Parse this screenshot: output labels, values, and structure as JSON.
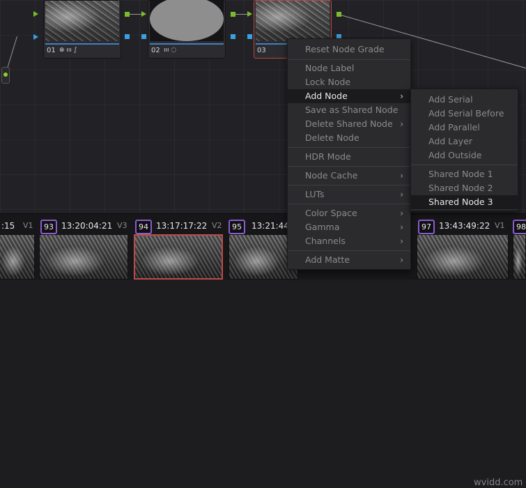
{
  "nodes": [
    {
      "id": "node-01",
      "label": "01",
      "icons": "⊗ ııı ∫"
    },
    {
      "id": "node-02",
      "label": "02",
      "icons": "ııı ◌"
    },
    {
      "id": "node-03",
      "label": "03",
      "icons": ""
    }
  ],
  "context_menu": {
    "items": [
      {
        "label": "Reset Node Grade"
      },
      {
        "label": "Node Label"
      },
      {
        "label": "Lock Node"
      },
      {
        "label": "Add Node",
        "submenu": true
      },
      {
        "label": "Save as Shared Node"
      },
      {
        "label": "Delete Shared Node",
        "submenu": true
      },
      {
        "label": "Delete Node"
      },
      {
        "label": "HDR Mode"
      },
      {
        "label": "Node Cache",
        "submenu": true
      },
      {
        "label": "LUTs",
        "submenu": true
      },
      {
        "label": "Color Space",
        "submenu": true
      },
      {
        "label": "Gamma",
        "submenu": true
      },
      {
        "label": "Channels",
        "submenu": true
      },
      {
        "label": "Add Matte",
        "submenu": true
      }
    ],
    "active_item": "Add Node",
    "chevron": "›"
  },
  "add_node_submenu": {
    "items": [
      {
        "label": "Add Serial"
      },
      {
        "label": "Add Serial Before"
      },
      {
        "label": "Add Parallel"
      },
      {
        "label": "Add Layer"
      },
      {
        "label": "Add Outside"
      },
      {
        "label": "Shared Node 1"
      },
      {
        "label": "Shared Node 2"
      },
      {
        "label": "Shared Node 3"
      }
    ],
    "highlighted_item": "Shared Node 3"
  },
  "clips": [
    {
      "number": "",
      "timecode": ":15",
      "track": "V1"
    },
    {
      "number": "93",
      "timecode": "13:20:04:21",
      "track": "V3"
    },
    {
      "number": "94",
      "timecode": "13:17:17:22",
      "track": "V2",
      "selected": true
    },
    {
      "number": "95",
      "timecode": "13:21:44:",
      "track": ""
    },
    {
      "number": "97",
      "timecode": "13:43:49:22",
      "track": "V1"
    },
    {
      "number": "98",
      "timecode": "",
      "track": ""
    }
  ],
  "watermark": "wvidd.com",
  "colors": {
    "panel_bg": "#222226",
    "node_link": "#7cbc2a",
    "node_output": "#3aa0e0",
    "selected_outline": "#b44646",
    "clip_badge": "#8a5cd0"
  },
  "icon_names": [
    "gear-icon",
    "chevron-right-icon",
    "input-dot-icon"
  ]
}
